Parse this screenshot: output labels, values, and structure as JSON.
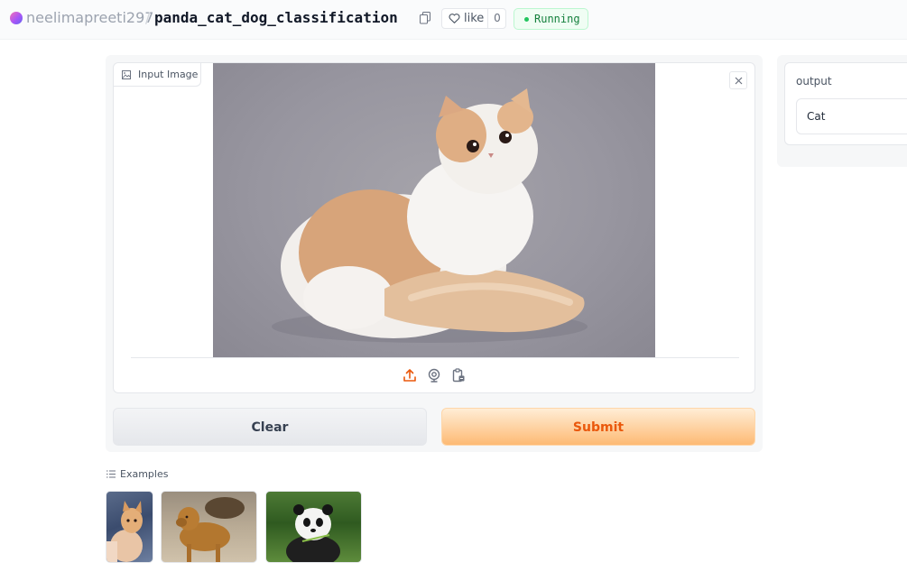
{
  "header": {
    "owner": "neelimapreeti297",
    "separator": "/",
    "repo_name": "panda_cat_dog_classification",
    "like_label": "like",
    "like_count": "0",
    "status": "Running",
    "status_color": "#22c55e"
  },
  "input": {
    "label": "Input Image",
    "source_icons": [
      "upload-icon",
      "webcam-icon",
      "clipboard-icon"
    ],
    "image_subject": "cat"
  },
  "buttons": {
    "clear": "Clear",
    "submit": "Submit",
    "submit_color": "#ea580c"
  },
  "output": {
    "label": "output",
    "value": "Cat"
  },
  "examples": {
    "label": "Examples",
    "items": [
      "cat",
      "dog",
      "panda"
    ]
  }
}
